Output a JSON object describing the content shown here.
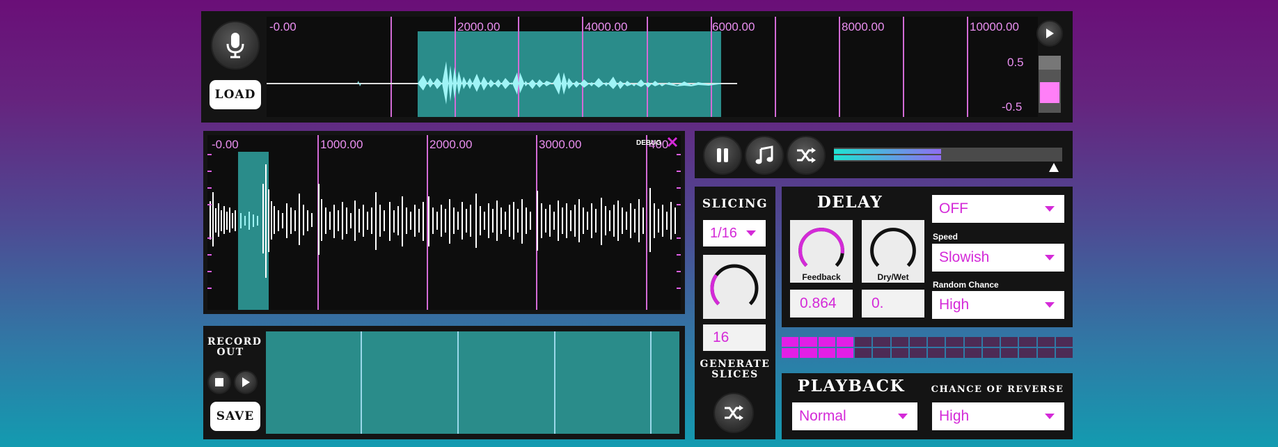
{
  "colors": {
    "accent_pink": "#d42ad8",
    "marker_pink": "#d36bd6",
    "teal_selection": "#2a8c8a",
    "waveform_cyan": "#9ff4f6",
    "panel_bg": "#141414"
  },
  "top_overview": {
    "load_label": "LOAD",
    "icons": {
      "mic": "microphone-icon",
      "play": "play-icon"
    },
    "ticks": [
      "-0.00",
      "2000.00",
      "4000.00",
      "6000.00",
      "8000.00",
      "10000.00"
    ],
    "gain_high": "0.5",
    "gain_low": "-0.5"
  },
  "detail_view": {
    "ticks": [
      "-0.00",
      "1000.00",
      "2000.00",
      "3000.00",
      "400"
    ],
    "debug_label": "DEBUG",
    "icons": {
      "close": "close-x-icon"
    }
  },
  "transport": {
    "icons": {
      "pause": "pause-icon",
      "music": "music-note-icon",
      "shuffle": "shuffle-icon",
      "playhead": "playhead-triangle-icon"
    },
    "progress": 0.47
  },
  "slicing": {
    "title": "SLICING",
    "division": "1/16",
    "slice_count": "16",
    "knob_level": 0.3,
    "generate_label": "GENERATE SLICES",
    "icons": {
      "shuffle": "shuffle-icon"
    }
  },
  "delay": {
    "title": "DELAY",
    "mode": "OFF",
    "feedback_label": "Feedback",
    "feedback_value": "0.864",
    "drywet_label": "Dry/Wet",
    "drywet_value": "0.",
    "speed_label": "Speed",
    "speed_value": "Slowish",
    "random_label": "Random Chance",
    "random_value": "High"
  },
  "step_grid": {
    "rows": 2,
    "columns": 16,
    "active_steps": 4
  },
  "record_out": {
    "title": "RECORD OUT",
    "save_label": "SAVE",
    "icons": {
      "stop": "stop-icon",
      "play": "play-icon"
    }
  },
  "playback": {
    "title": "PLAYBACK",
    "mode": "Normal",
    "reverse_label": "CHANCE OF REVERSE",
    "reverse_value": "High"
  }
}
